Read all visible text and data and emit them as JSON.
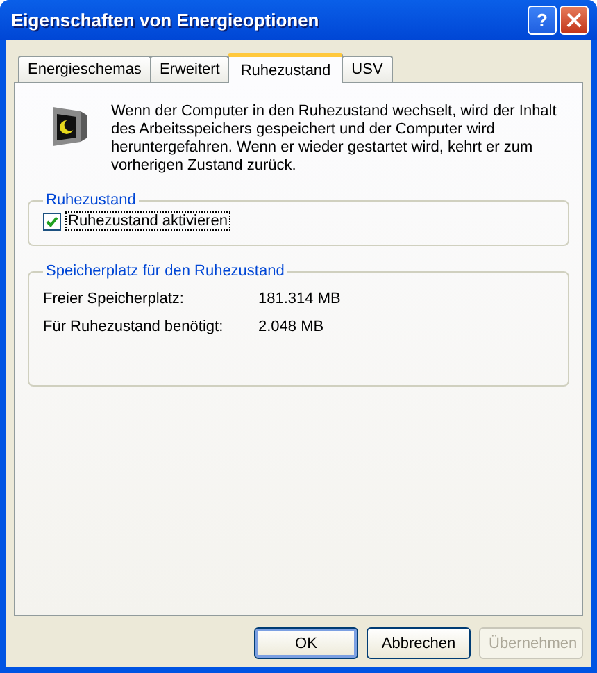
{
  "window": {
    "title": "Eigenschaften von Energieoptionen",
    "help_button": "?"
  },
  "tabs": [
    {
      "label": "Energieschemas",
      "selected": false
    },
    {
      "label": "Erweitert",
      "selected": false
    },
    {
      "label": "Ruhezustand",
      "selected": true
    },
    {
      "label": "USV",
      "selected": false
    }
  ],
  "description": "Wenn der Computer in den Ruhezustand wechselt, wird der Inhalt des Arbeitsspeichers gespeichert und der Computer wird heruntergefahren. Wenn er wieder gestartet wird, kehrt er zum vorherigen Zustand zurück.",
  "hibernate_group": {
    "title": "Ruhezustand",
    "checkbox": {
      "label": "Ruhezustand aktivieren",
      "checked": true
    }
  },
  "space_group": {
    "title": "Speicherplatz für den Ruhezustand",
    "rows": [
      {
        "label": "Freier Speicherplatz:",
        "value": "181.314 MB"
      },
      {
        "label": "Für Ruhezustand benötigt:",
        "value": "2.048 MB"
      }
    ]
  },
  "buttons": [
    {
      "label": "OK",
      "default": true,
      "disabled": false
    },
    {
      "label": "Abbrechen",
      "default": false,
      "disabled": false
    },
    {
      "label": "Übernehmen",
      "default": false,
      "disabled": true
    }
  ]
}
